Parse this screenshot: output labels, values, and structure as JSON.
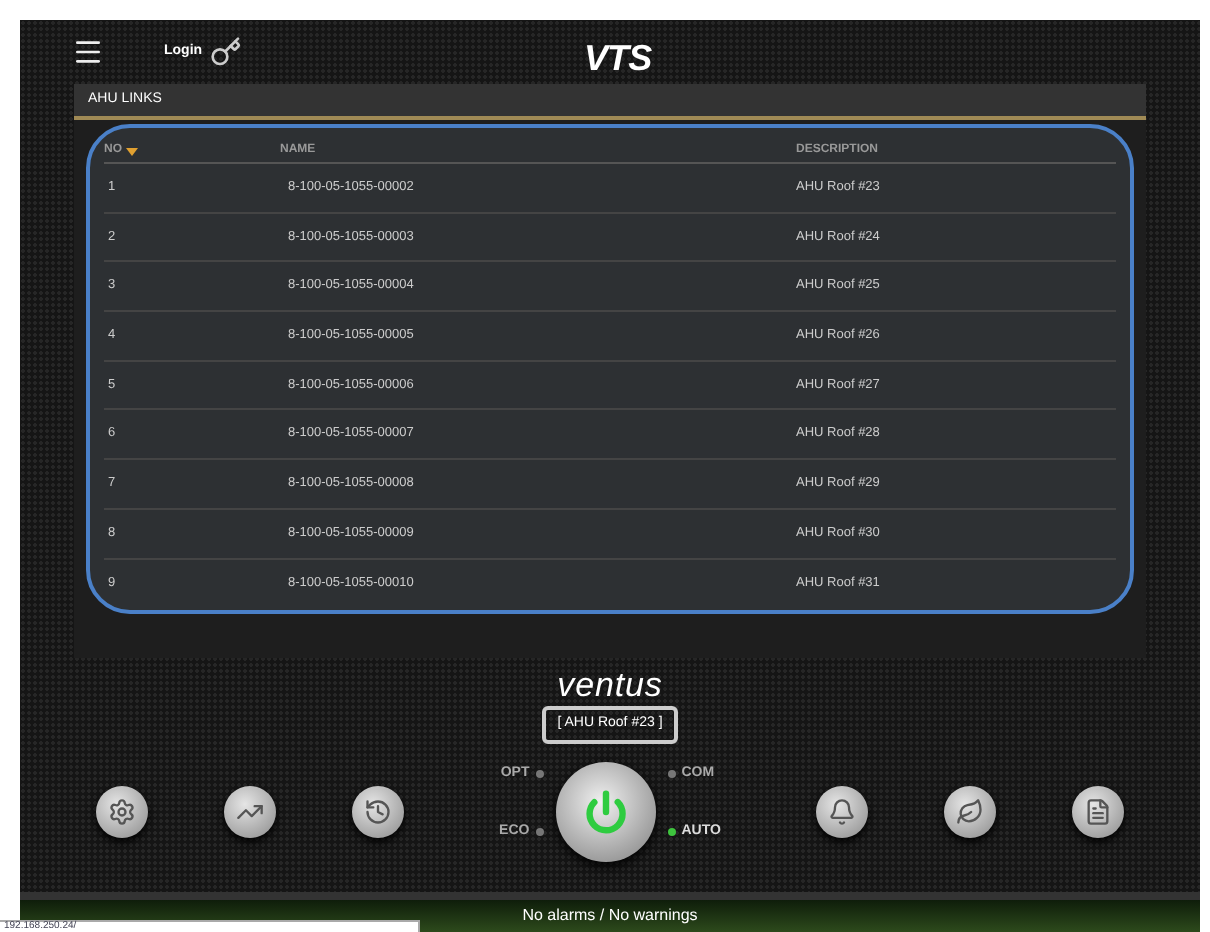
{
  "header": {
    "login": "Login",
    "logo": "VTS"
  },
  "panel": {
    "title": "AHU LINKS",
    "columns": [
      {
        "label": "NO",
        "sorted": true
      },
      {
        "label": "NAME",
        "sorted": false
      },
      {
        "label": "DESCRIPTION",
        "sorted": false
      }
    ],
    "rows": [
      [
        "1",
        "8-100-05-1055-00002",
        "AHU Roof #23"
      ],
      [
        "2",
        "8-100-05-1055-00003",
        "AHU Roof #24"
      ],
      [
        "3",
        "8-100-05-1055-00004",
        "AHU Roof #25"
      ],
      [
        "4",
        "8-100-05-1055-00005",
        "AHU Roof #26"
      ],
      [
        "5",
        "8-100-05-1055-00006",
        "AHU Roof #27"
      ],
      [
        "6",
        "8-100-05-1055-00007",
        "AHU Roof #28"
      ],
      [
        "7",
        "8-100-05-1055-00008",
        "AHU Roof #29"
      ],
      [
        "8",
        "8-100-05-1055-00009",
        "AHU Roof #30"
      ],
      [
        "9",
        "8-100-05-1055-00010",
        "AHU Roof #31"
      ]
    ]
  },
  "device": {
    "brand": "ventus",
    "unit": "[ AHU Roof #23 ]"
  },
  "modes": [
    {
      "label": "OPT",
      "on": false
    },
    {
      "label": "COM",
      "on": false
    },
    {
      "label": "ECO",
      "on": false
    },
    {
      "label": "AUTO",
      "on": true
    }
  ],
  "power": {
    "on": true
  },
  "left_buttons": [
    {
      "kind": "settings"
    },
    {
      "kind": "chart"
    },
    {
      "kind": "history"
    }
  ],
  "right_buttons": [
    {
      "kind": "alarm"
    },
    {
      "kind": "eco"
    },
    {
      "kind": "report"
    }
  ],
  "status_bar": "No alarms / No warnings",
  "link_preview": "192.168.250.24/"
}
